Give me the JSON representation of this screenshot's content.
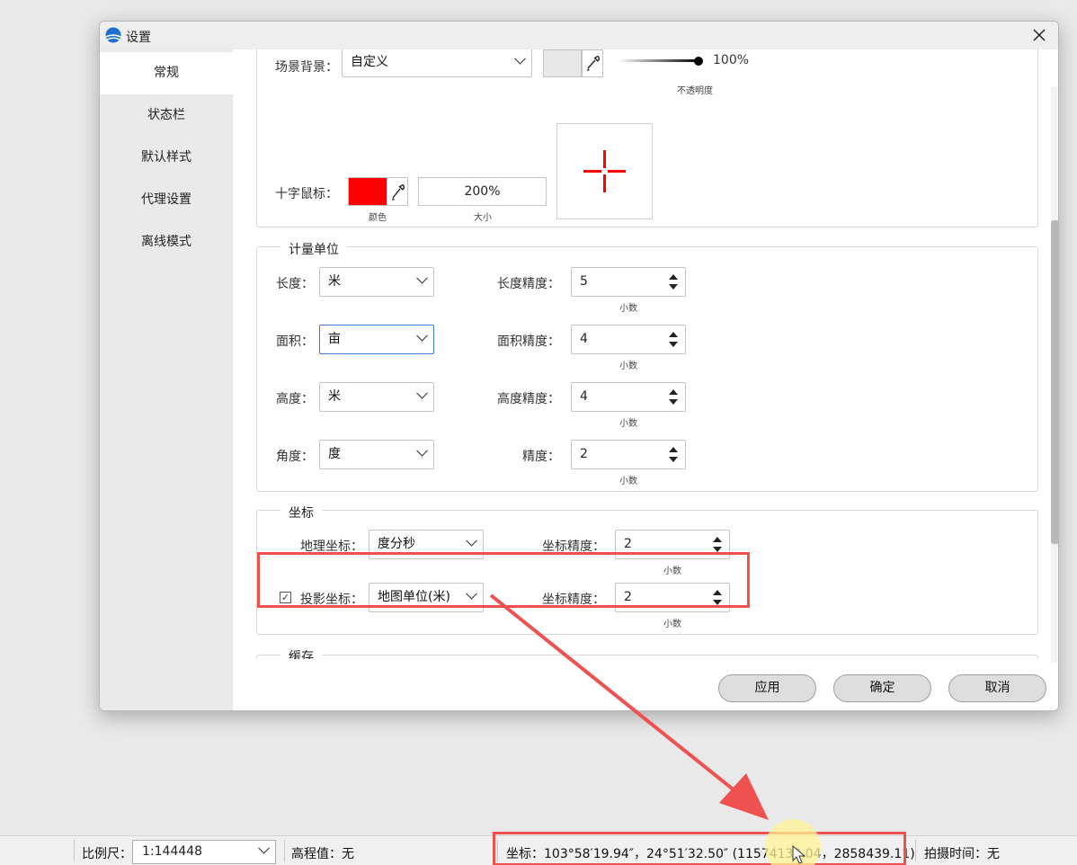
{
  "dialog": {
    "title": "设置",
    "sidebar": [
      {
        "label": "常规"
      },
      {
        "label": "状态栏"
      },
      {
        "label": "默认样式"
      },
      {
        "label": "代理设置"
      },
      {
        "label": "离线模式"
      }
    ],
    "scene": {
      "bg_label": "场景背景：",
      "bg_value": "自定义",
      "opacity_value": "100%",
      "opacity_caption": "不透明度",
      "crosshair_label": "十字鼠标：",
      "crosshair_color": "#ff0000",
      "color_caption": "颜色",
      "size_value": "200%",
      "size_caption": "大小",
      "bg_swatch_color": "#e8e8e8"
    },
    "units": {
      "title": "计量单位",
      "length_label": "长度：",
      "length_value": "米",
      "length_precision_label": "长度精度：",
      "length_precision_value": "5",
      "area_label": "面积：",
      "area_value": "亩",
      "area_precision_label": "面积精度：",
      "area_precision_value": "4",
      "height_label": "高度：",
      "height_value": "米",
      "height_precision_label": "高度精度：",
      "height_precision_value": "4",
      "angle_label": "角度：",
      "angle_value": "度",
      "precision_label": "精度：",
      "precision_value": "2",
      "decimal_caption": "小数"
    },
    "coords": {
      "title": "坐标",
      "geo_label": "地理坐标：",
      "geo_value": "度分秒",
      "geo_precision_label": "坐标精度：",
      "geo_precision_value": "2",
      "proj_label": "投影坐标：",
      "proj_checked": true,
      "proj_value": "地图单位(米)",
      "proj_precision_label": "坐标精度：",
      "proj_precision_value": "2",
      "decimal_caption": "小数"
    },
    "cache_title": "缓存",
    "buttons": {
      "apply": "应用",
      "ok": "确定",
      "cancel": "取消"
    }
  },
  "statusbar": {
    "scale_label": "比例尺：",
    "scale_value": "1:144448",
    "elevation": "高程值：无",
    "coords": "坐标：103°58′19.94″，24°51′32.50″   (11574133.04，2858439.11)",
    "capture_time": "拍摄时间：无"
  },
  "colors": {
    "annotation": "#ef5050",
    "focus": "#3d7fce"
  }
}
